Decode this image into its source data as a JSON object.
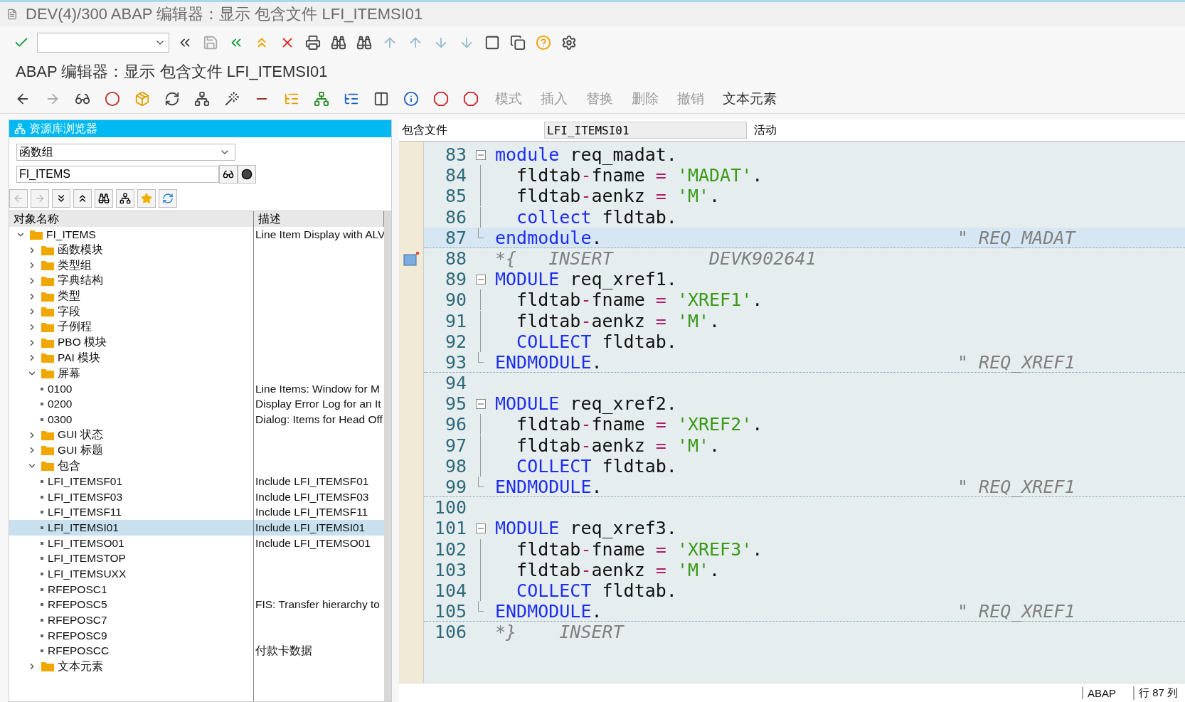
{
  "window": {
    "title": "DEV(4)/300 ABAP 编辑器：显示 包含文件 LFI_ITEMSI01"
  },
  "screen_title": "ABAP 编辑器：显示 包含文件 LFI_ITEMSI01",
  "app_toolbar": [
    {
      "label": "模式",
      "disabled": true
    },
    {
      "label": "插入",
      "disabled": true
    },
    {
      "label": "替换",
      "disabled": true
    },
    {
      "label": "删除",
      "disabled": true
    },
    {
      "label": "撤销",
      "disabled": true
    },
    {
      "label": "文本元素",
      "disabled": false
    }
  ],
  "repository_browser": {
    "title": "资源库浏览器",
    "object_type": "函数组",
    "object_name": "FI_ITEMS",
    "columns": [
      "对象名称",
      "描述"
    ],
    "tree": [
      {
        "label": "FI_ITEMS",
        "desc": "Line Item Display with ALV",
        "kind": "folder",
        "expanded": true,
        "selected": false,
        "children": [
          {
            "label": "函数模块",
            "kind": "folder",
            "expanded": false,
            "selected": false
          },
          {
            "label": "类型组",
            "kind": "folder",
            "expanded": false,
            "selected": false
          },
          {
            "label": "字典结构",
            "kind": "folder",
            "expanded": false,
            "selected": false
          },
          {
            "label": "类型",
            "kind": "folder",
            "expanded": false,
            "selected": false
          },
          {
            "label": "字段",
            "kind": "folder",
            "expanded": false,
            "selected": false
          },
          {
            "label": "子例程",
            "kind": "folder",
            "expanded": false,
            "selected": false
          },
          {
            "label": "PBO 模块",
            "kind": "folder",
            "expanded": false,
            "selected": false
          },
          {
            "label": "PAI 模块",
            "kind": "folder",
            "expanded": false,
            "selected": false
          },
          {
            "label": "屏幕",
            "kind": "folder",
            "expanded": true,
            "selected": false,
            "children": [
              {
                "label": "0100",
                "desc": "Line Items: Window for M",
                "kind": "leaf",
                "selected": false
              },
              {
                "label": "0200",
                "desc": "Display Error Log for an It",
                "kind": "leaf",
                "selected": false
              },
              {
                "label": "0300",
                "desc": "Dialog: Items for Head Off",
                "kind": "leaf",
                "selected": false
              }
            ]
          },
          {
            "label": "GUI 状态",
            "kind": "folder",
            "expanded": false,
            "selected": false
          },
          {
            "label": "GUI 标题",
            "kind": "folder",
            "expanded": false,
            "selected": false
          },
          {
            "label": "包含",
            "kind": "folder",
            "expanded": true,
            "selected": false,
            "children": [
              {
                "label": "LFI_ITEMSF01",
                "desc": "Include LFI_ITEMSF01",
                "kind": "leaf",
                "selected": false
              },
              {
                "label": "LFI_ITEMSF03",
                "desc": "Include LFI_ITEMSF03",
                "kind": "leaf",
                "selected": false
              },
              {
                "label": "LFI_ITEMSF11",
                "desc": "Include LFI_ITEMSF11",
                "kind": "leaf",
                "selected": false
              },
              {
                "label": "LFI_ITEMSI01",
                "desc": "Include LFI_ITEMSI01",
                "kind": "leaf",
                "selected": true
              },
              {
                "label": "LFI_ITEMSO01",
                "desc": "Include LFI_ITEMSO01",
                "kind": "leaf",
                "selected": false
              },
              {
                "label": "LFI_ITEMSTOP",
                "kind": "leaf",
                "selected": false
              },
              {
                "label": "LFI_ITEMSUXX",
                "kind": "leaf",
                "selected": false
              },
              {
                "label": "RFEPOSC1",
                "kind": "leaf",
                "selected": false
              },
              {
                "label": "RFEPOSC5",
                "desc": "FIS: Transfer hierarchy to",
                "kind": "leaf",
                "selected": false
              },
              {
                "label": "RFEPOSC7",
                "kind": "leaf",
                "selected": false
              },
              {
                "label": "RFEPOSC9",
                "kind": "leaf",
                "selected": false
              },
              {
                "label": "RFEPOSCC",
                "desc": "付款卡数据",
                "kind": "leaf",
                "selected": false
              }
            ]
          },
          {
            "label": "文本元素",
            "kind": "folder",
            "expanded": false,
            "selected": false
          }
        ]
      }
    ]
  },
  "editor": {
    "label": "包含文件",
    "program": "LFI_ITEMSI01",
    "status": "活动",
    "lines": [
      {
        "no": "83",
        "kind": "start",
        "current": false,
        "bookmark": false,
        "code": [
          {
            "kind": "keyword",
            "text": "module"
          },
          {
            "kind": "plain",
            "text": " req_madat."
          }
        ]
      },
      {
        "no": "84",
        "kind": "inner",
        "current": false,
        "bookmark": false,
        "code": [
          {
            "kind": "plain",
            "text": "  fldtab"
          },
          {
            "kind": "operator",
            "text": "-"
          },
          {
            "kind": "plain",
            "text": "fname"
          },
          {
            "kind": "operator",
            "text": " = "
          },
          {
            "kind": "string",
            "text": "'MADAT'"
          },
          {
            "kind": "plain",
            "text": "."
          }
        ]
      },
      {
        "no": "85",
        "kind": "inner",
        "current": false,
        "bookmark": false,
        "code": [
          {
            "kind": "plain",
            "text": "  fldtab"
          },
          {
            "kind": "operator",
            "text": "-"
          },
          {
            "kind": "plain",
            "text": "aenkz"
          },
          {
            "kind": "operator",
            "text": " = "
          },
          {
            "kind": "string",
            "text": "'M'"
          },
          {
            "kind": "plain",
            "text": "."
          }
        ]
      },
      {
        "no": "86",
        "kind": "inner",
        "current": false,
        "bookmark": false,
        "code": [
          {
            "kind": "keyword",
            "text": "  collect"
          },
          {
            "kind": "plain",
            "text": " fldtab."
          }
        ]
      },
      {
        "no": "87",
        "kind": "end",
        "current": true,
        "bookmark": false,
        "code": [
          {
            "kind": "keyword",
            "text": "endmodule"
          },
          {
            "kind": "plain",
            "text": "."
          }
        ],
        "end_comment": "\" REQ_MADAT"
      },
      {
        "no": "88",
        "kind": "plain",
        "current": false,
        "bookmark": true,
        "code": [
          {
            "kind": "comment",
            "text": "*{   INSERT         DEVK902641"
          }
        ]
      },
      {
        "no": "89",
        "kind": "start",
        "current": false,
        "bookmark": false,
        "code": [
          {
            "kind": "keyword",
            "text": "MODULE"
          },
          {
            "kind": "plain",
            "text": " req_xref1."
          }
        ]
      },
      {
        "no": "90",
        "kind": "inner",
        "current": false,
        "bookmark": false,
        "code": [
          {
            "kind": "plain",
            "text": "  fldtab"
          },
          {
            "kind": "operator",
            "text": "-"
          },
          {
            "kind": "plain",
            "text": "fname"
          },
          {
            "kind": "operator",
            "text": " = "
          },
          {
            "kind": "string",
            "text": "'XREF1'"
          },
          {
            "kind": "plain",
            "text": "."
          }
        ]
      },
      {
        "no": "91",
        "kind": "inner",
        "current": false,
        "bookmark": false,
        "code": [
          {
            "kind": "plain",
            "text": "  fldtab"
          },
          {
            "kind": "operator",
            "text": "-"
          },
          {
            "kind": "plain",
            "text": "aenkz"
          },
          {
            "kind": "operator",
            "text": " = "
          },
          {
            "kind": "string",
            "text": "'M'"
          },
          {
            "kind": "plain",
            "text": "."
          }
        ]
      },
      {
        "no": "92",
        "kind": "inner",
        "current": false,
        "bookmark": false,
        "code": [
          {
            "kind": "keyword",
            "text": "  COLLECT"
          },
          {
            "kind": "plain",
            "text": " fldtab."
          }
        ]
      },
      {
        "no": "93",
        "kind": "end",
        "current": false,
        "bookmark": false,
        "code": [
          {
            "kind": "keyword",
            "text": "ENDMODULE"
          },
          {
            "kind": "plain",
            "text": "."
          }
        ],
        "end_comment": "\" REQ_XREF1"
      },
      {
        "no": "94",
        "kind": "plain",
        "current": false,
        "bookmark": false
      },
      {
        "no": "95",
        "kind": "start",
        "current": false,
        "bookmark": false,
        "code": [
          {
            "kind": "keyword",
            "text": "MODULE"
          },
          {
            "kind": "plain",
            "text": " req_xref2."
          }
        ]
      },
      {
        "no": "96",
        "kind": "inner",
        "current": false,
        "bookmark": false,
        "code": [
          {
            "kind": "plain",
            "text": "  fldtab"
          },
          {
            "kind": "operator",
            "text": "-"
          },
          {
            "kind": "plain",
            "text": "fname"
          },
          {
            "kind": "operator",
            "text": " = "
          },
          {
            "kind": "string",
            "text": "'XREF2'"
          },
          {
            "kind": "plain",
            "text": "."
          }
        ]
      },
      {
        "no": "97",
        "kind": "inner",
        "current": false,
        "bookmark": false,
        "code": [
          {
            "kind": "plain",
            "text": "  fldtab"
          },
          {
            "kind": "operator",
            "text": "-"
          },
          {
            "kind": "plain",
            "text": "aenkz"
          },
          {
            "kind": "operator",
            "text": " = "
          },
          {
            "kind": "string",
            "text": "'M'"
          },
          {
            "kind": "plain",
            "text": "."
          }
        ]
      },
      {
        "no": "98",
        "kind": "inner",
        "current": false,
        "bookmark": false,
        "code": [
          {
            "kind": "keyword",
            "text": "  COLLECT"
          },
          {
            "kind": "plain",
            "text": " fldtab."
          }
        ]
      },
      {
        "no": "99",
        "kind": "end",
        "current": false,
        "bookmark": false,
        "code": [
          {
            "kind": "keyword",
            "text": "ENDMODULE"
          },
          {
            "kind": "plain",
            "text": "."
          }
        ],
        "end_comment": "\" REQ_XREF1"
      },
      {
        "no": "100",
        "kind": "plain",
        "current": false,
        "bookmark": false
      },
      {
        "no": "101",
        "kind": "start",
        "current": false,
        "bookmark": false,
        "code": [
          {
            "kind": "keyword",
            "text": "MODULE"
          },
          {
            "kind": "plain",
            "text": " req_xref3."
          }
        ]
      },
      {
        "no": "102",
        "kind": "inner",
        "current": false,
        "bookmark": false,
        "code": [
          {
            "kind": "plain",
            "text": "  fldtab"
          },
          {
            "kind": "operator",
            "text": "-"
          },
          {
            "kind": "plain",
            "text": "fname"
          },
          {
            "kind": "operator",
            "text": " = "
          },
          {
            "kind": "string",
            "text": "'XREF3'"
          },
          {
            "kind": "plain",
            "text": "."
          }
        ]
      },
      {
        "no": "103",
        "kind": "inner",
        "current": false,
        "bookmark": false,
        "code": [
          {
            "kind": "plain",
            "text": "  fldtab"
          },
          {
            "kind": "operator",
            "text": "-"
          },
          {
            "kind": "plain",
            "text": "aenkz"
          },
          {
            "kind": "operator",
            "text": " = "
          },
          {
            "kind": "string",
            "text": "'M'"
          },
          {
            "kind": "plain",
            "text": "."
          }
        ]
      },
      {
        "no": "104",
        "kind": "inner",
        "current": false,
        "bookmark": false,
        "code": [
          {
            "kind": "keyword",
            "text": "  COLLECT"
          },
          {
            "kind": "plain",
            "text": " fldtab."
          }
        ]
      },
      {
        "no": "105",
        "kind": "end",
        "current": false,
        "bookmark": false,
        "code": [
          {
            "kind": "keyword",
            "text": "ENDMODULE"
          },
          {
            "kind": "plain",
            "text": "."
          }
        ],
        "end_comment": "\" REQ_XREF1"
      },
      {
        "no": "106",
        "kind": "plain",
        "current": false,
        "bookmark": false,
        "code": [
          {
            "kind": "comment",
            "text": "*}    INSERT"
          }
        ]
      }
    ]
  },
  "status_bar": {
    "language": "ABAP",
    "position": "行 87 列"
  }
}
